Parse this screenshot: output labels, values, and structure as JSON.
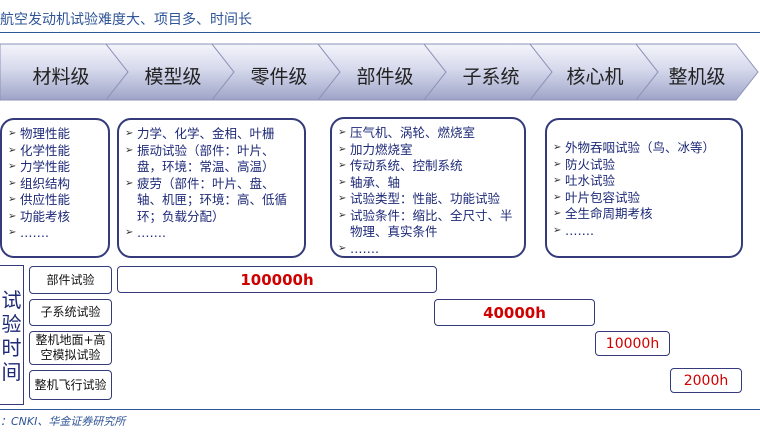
{
  "title": "航空发动机试验难度大、项目多、时间长",
  "source": "：CNKI、华金证券研究所",
  "stages": [
    "材料级",
    "模型级",
    "零件级",
    "部件级",
    "子系统",
    "核心机",
    "整机级"
  ],
  "boxes": {
    "material": [
      "物理性能",
      "化学性能",
      "力学性能",
      "组织结构",
      "供应性能",
      "功能考核",
      "……."
    ],
    "model": [
      "力学、化学、金相、叶栅",
      "振动试验（部件：叶片、盘，环境：常温、高温）",
      "疲劳（部件：叶片、盘、轴、机匣；环境：高、低循环；负载分配）",
      "……."
    ],
    "component": [
      "压气机、涡轮、燃烧室",
      "加力燃烧室",
      "传动系统、控制系统",
      "轴承、轴",
      "试验类型：性能、功能试验",
      "试验条件：缩比、全尺寸、半物理、真实条件",
      "……."
    ],
    "engine": [
      "外物吞咽试验（鸟、冰等）",
      "防火试验",
      "吐水试验",
      "叶片包容试验",
      "全生命周期考核",
      "……."
    ]
  },
  "test_time_label": [
    "试",
    "验",
    "时",
    "间"
  ],
  "test_rows": [
    {
      "label": "部件试验",
      "value": "100000h"
    },
    {
      "label": "子系统试验",
      "value": "40000h"
    },
    {
      "label": "整机地面+高空模拟试验",
      "value": "10000h"
    },
    {
      "label": "整机飞行试验",
      "value": "2000h"
    }
  ],
  "colors": {
    "accent": "#2f5597",
    "border": "#343a7a",
    "value_red": "#d00000"
  }
}
